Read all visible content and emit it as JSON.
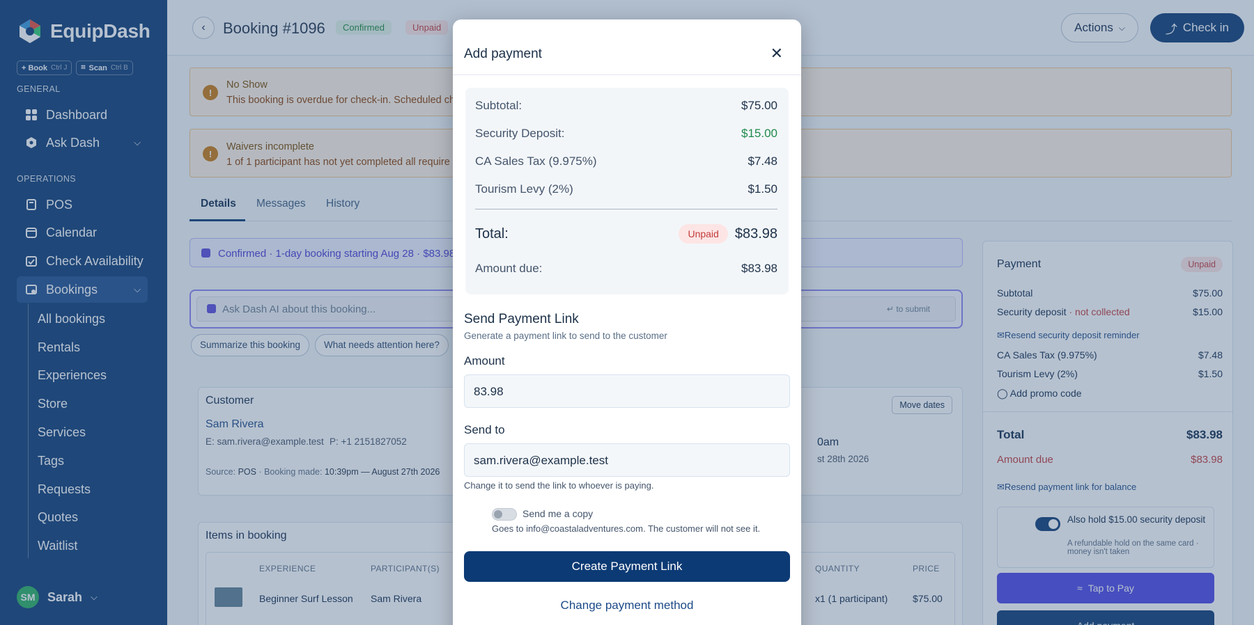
{
  "app": {
    "name": "EquipDash"
  },
  "quick": [
    {
      "label": "+ Book",
      "kbd": "Ctrl J"
    },
    {
      "label": "Scan",
      "kbd": "Ctrl B"
    }
  ],
  "sidebar": {
    "general_label": "GENERAL",
    "operations_label": "OPERATIONS",
    "dashboard": "Dashboard",
    "ask_dash": "Ask Dash",
    "pos": "POS",
    "calendar": "Calendar",
    "check_availability": "Check Availability",
    "bookings": "Bookings",
    "sub": [
      "All bookings",
      "Rentals",
      "Experiences",
      "Store",
      "Services",
      "Tags",
      "Requests",
      "Quotes",
      "Waitlist"
    ],
    "user": {
      "initials": "SM",
      "name": "Sarah"
    }
  },
  "header": {
    "title": "Booking #1096",
    "status_confirmed": "Confirmed",
    "status_unpaid": "Unpaid",
    "actions": "Actions",
    "check_in": "Check in"
  },
  "alerts": [
    {
      "title": "No Show",
      "text": "This booking is overdue for check-in. Scheduled che"
    },
    {
      "title": "Waivers incomplete",
      "text": "1 of 1 participant has not yet completed all require"
    }
  ],
  "tabs": [
    "Details",
    "Messages",
    "History"
  ],
  "info_bar": "Confirmed · 1-day booking starting Aug 28 · $83.98",
  "ask": {
    "placeholder": "Ask Dash AI about this booking...",
    "hint": "to submit"
  },
  "suggestions": [
    "Summarize this booking",
    "What needs attention here?"
  ],
  "customer": {
    "heading": "Customer",
    "name": "Sam Rivera",
    "email": "E: sam.rivera@example.test",
    "phone": "P: +1 2151827052",
    "source_label": "Source:",
    "source": "POS",
    "made_label": "Booking made:",
    "made": "10:39pm — August 27th 2026",
    "move_dates": "Move dates",
    "time_partial": "0am",
    "date_partial": "st 28th 2026"
  },
  "items": {
    "heading": "Items in booking",
    "columns": [
      "EXPERIENCE",
      "PARTICIPANT(S)",
      "QUANTITY",
      "PRICE"
    ],
    "row": {
      "experience": "Beginner Surf Lesson",
      "participant": "Sam Rivera",
      "quantity": "x1 (1 participant)",
      "price": "$75.00"
    }
  },
  "payment_card": {
    "title": "Payment",
    "badge": "Unpaid",
    "subtotal_label": "Subtotal",
    "subtotal": "$75.00",
    "deposit_label": "Security deposit",
    "deposit_note": " · not collected",
    "deposit": "$15.00",
    "resend_deposit": "Resend security deposit reminder",
    "tax_label": "CA Sales Tax (9.975%)",
    "tax": "$7.48",
    "levy_label": "Tourism Levy (2%)",
    "levy": "$1.50",
    "promo": "Add promo code",
    "total_label": "Total",
    "total": "$83.98",
    "due_label": "Amount due",
    "due": "$83.98",
    "resend_balance": "Resend payment link for balance",
    "hold_title": "Also hold $15.00 security deposit",
    "hold_note": "A refundable hold on the same card · money isn't taken",
    "tap_to_pay": "Tap to Pay",
    "add_payment": "Add payment"
  },
  "modal": {
    "title": "Add payment",
    "subtotal_label": "Subtotal:",
    "subtotal": "$75.00",
    "deposit_label": "Security Deposit:",
    "deposit": "$15.00",
    "tax_label": "CA Sales Tax (9.975%)",
    "tax": "$7.48",
    "levy_label": "Tourism Levy (2%)",
    "levy": "$1.50",
    "total_label": "Total:",
    "status": "Unpaid",
    "total": "$83.98",
    "due_label": "Amount due:",
    "due": "$83.98",
    "link_title": "Send Payment Link",
    "link_sub": "Generate a payment link to send to the customer",
    "amount_label": "Amount",
    "amount": "83.98",
    "send_to_label": "Send to",
    "send_to": "sam.rivera@example.test",
    "send_help": "Change it to send the link to whoever is paying.",
    "copy_label": "Send me a copy",
    "copy_help": "Goes to info@coastaladventures.com. The customer will not see it.",
    "create_btn": "Create Payment Link",
    "change_method": "Change payment method"
  },
  "colors": {
    "sidebar": "#0c3a74",
    "accent": "#0c3a74",
    "ai": "#5b4bdc",
    "danger": "#c23b3b",
    "success": "#1f8a4c"
  }
}
